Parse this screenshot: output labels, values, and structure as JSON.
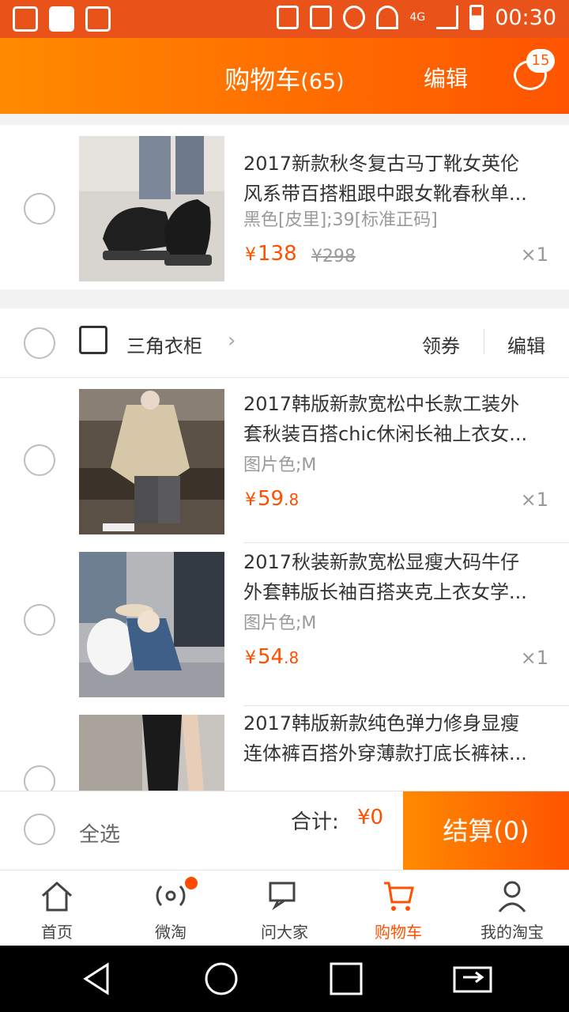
{
  "status_bar": {
    "time": "00:30",
    "network": "4G"
  },
  "header": {
    "title": "购物车",
    "count": "(65)",
    "edit_label": "编辑",
    "message_badge": "15"
  },
  "items_top": [
    {
      "title_line1": "2017新款秋冬复古马丁靴女英伦",
      "title_line2": "风系带百搭粗跟中跟女靴春秋单...",
      "variant": "黑色[皮里];39[标准正码]",
      "price_yen": "¥",
      "price_int": "138",
      "price_dec": "",
      "original_price": "¥298",
      "qty": "×1",
      "image_icon": "boots-photo"
    }
  ],
  "shop": {
    "name": "三角衣柜",
    "coupon_label": "领券",
    "edit_label": "编辑",
    "icon": "store-icon"
  },
  "shop_items": [
    {
      "title_line1": "2017韩版新款宽松中长款工装外",
      "title_line2": "套秋装百搭chic休闲长袖上衣女...",
      "variant": "图片色;M",
      "price_yen": "¥",
      "price_int": "59",
      "price_dec": ".8",
      "qty": "×1",
      "image_icon": "jacket-photo"
    },
    {
      "title_line1": "2017秋装新款宽松显瘦大码牛仔",
      "title_line2": "外套韩版长袖百搭夹克上衣女学...",
      "variant": "图片色;M",
      "price_yen": "¥",
      "price_int": "54",
      "price_dec": ".8",
      "qty": "×1",
      "image_icon": "denim-photo"
    },
    {
      "title_line1": "2017韩版新款纯色弹力修身显瘦",
      "title_line2": "连体裤百搭外穿薄款打底长裤袜...",
      "image_icon": "leggings-photo"
    }
  ],
  "footer": {
    "select_all": "全选",
    "total_label": "合计:",
    "total_value": "¥0",
    "checkout_label": "结算(0)"
  },
  "tabs": [
    {
      "label": "首页",
      "icon": "home-icon"
    },
    {
      "label": "微淘",
      "icon": "broadcast-icon"
    },
    {
      "label": "问大家",
      "icon": "chat-icon"
    },
    {
      "label": "购物车",
      "icon": "cart-icon",
      "active": true
    },
    {
      "label": "我的淘宝",
      "icon": "user-icon"
    }
  ],
  "colors": {
    "accent": "#ff5000",
    "header_start": "#ff8a00",
    "header_end": "#ff5400",
    "status_bar": "#e9531a"
  }
}
